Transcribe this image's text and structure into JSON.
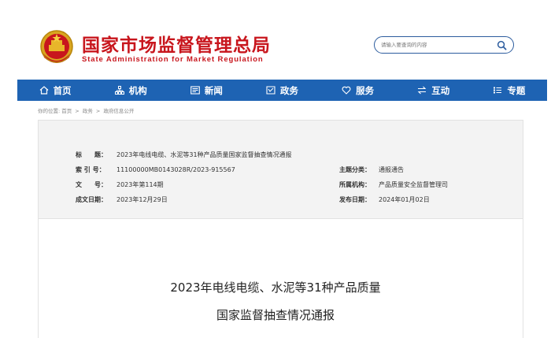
{
  "header": {
    "title": "国家市场监督管理总局",
    "subtitle": "State Administration for Market Regulation"
  },
  "search": {
    "placeholder": "请输入要查询的内容"
  },
  "nav": [
    {
      "label": "首页",
      "icon": "home-icon"
    },
    {
      "label": "机构",
      "icon": "org-icon"
    },
    {
      "label": "新闻",
      "icon": "news-icon"
    },
    {
      "label": "政务",
      "icon": "gov-icon"
    },
    {
      "label": "服务",
      "icon": "heart-icon"
    },
    {
      "label": "互动",
      "icon": "exchange-icon"
    },
    {
      "label": "专题",
      "icon": "list-icon"
    }
  ],
  "breadcrumb": {
    "prefix": "你的位置:",
    "items": [
      "首页",
      "政务",
      "政府信息公开"
    ],
    "sep": ">"
  },
  "meta": {
    "title_label": "标　　题：",
    "title_value": "2023年电线电缆、水泥等31种产品质量国家监督抽查情况通报",
    "index_label": "索 引 号：",
    "index_value": "11100000MB0143028R/2023-915567",
    "topic_label": "主题分类：",
    "topic_value": "通报通告",
    "docno_label": "文　　号：",
    "docno_value": "2023年第114期",
    "agency_label": "所属机构：",
    "agency_value": "产品质量安全监督管理司",
    "created_label": "成文日期：",
    "created_value": "2023年12月29日",
    "published_label": "发布日期：",
    "published_value": "2024年01月02日"
  },
  "document": {
    "title_line1": "2023年电线电缆、水泥等31种产品质量",
    "title_line2": "国家监督抽查情况通报"
  },
  "colors": {
    "brand_red": "#c8161d",
    "nav_blue": "#1e63b3"
  }
}
